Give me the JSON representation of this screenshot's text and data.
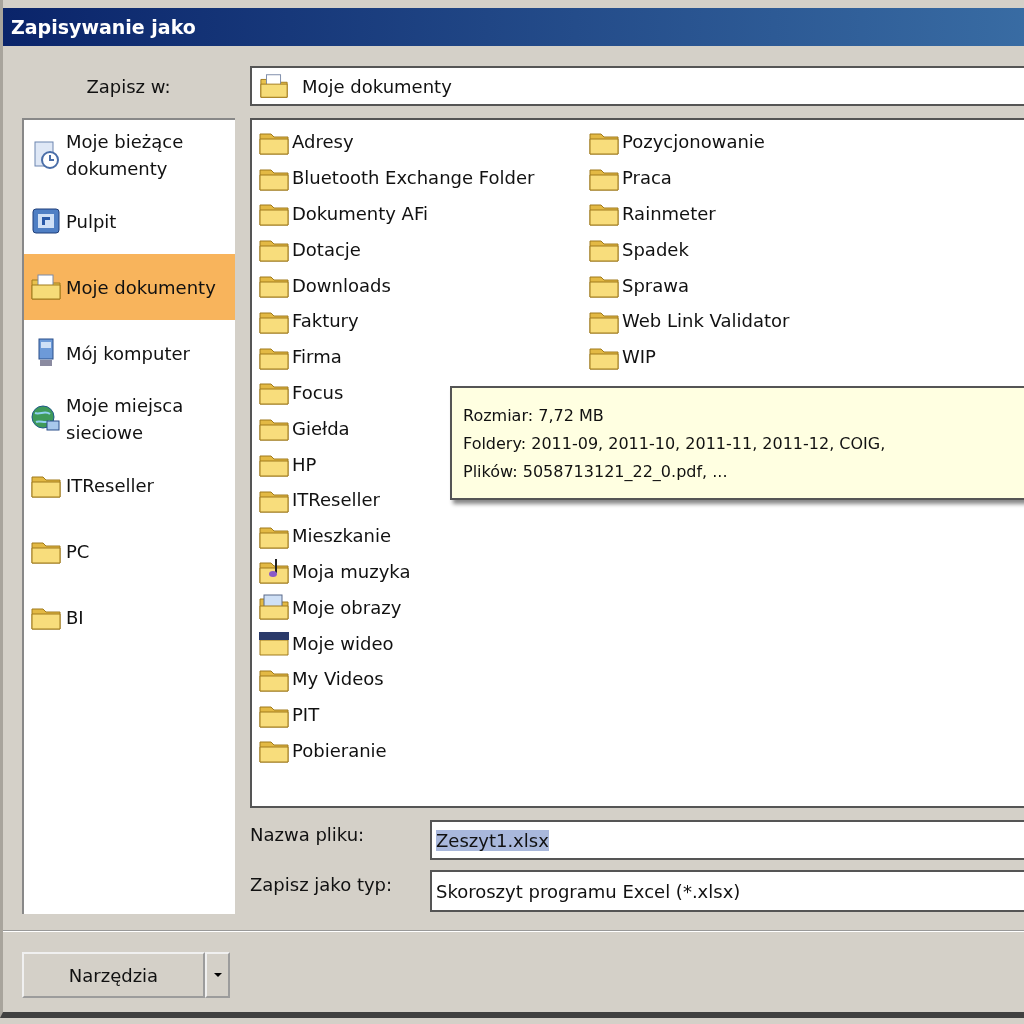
{
  "window": {
    "title": "Zapisywanie jako"
  },
  "location": {
    "label": "Zapisz w:",
    "value": "Moje dokumenty"
  },
  "places": [
    {
      "label": "Moje bieżące dokumenty",
      "kind": "recent",
      "selected": false
    },
    {
      "label": "Pulpit",
      "kind": "desktop",
      "selected": false
    },
    {
      "label": "Moje dokumenty",
      "kind": "documents",
      "selected": true
    },
    {
      "label": "Mój komputer",
      "kind": "computer",
      "selected": false
    },
    {
      "label": "Moje miejsca sieciowe",
      "kind": "network",
      "selected": false
    },
    {
      "label": "ITReseller",
      "kind": "folder",
      "selected": false
    },
    {
      "label": "PC",
      "kind": "folder",
      "selected": false
    },
    {
      "label": "BI",
      "kind": "folder",
      "selected": false
    }
  ],
  "files": [
    {
      "name": "Adresy",
      "kind": "folder"
    },
    {
      "name": "Bluetooth Exchange Folder",
      "kind": "folder"
    },
    {
      "name": "Dokumenty AFi",
      "kind": "folder"
    },
    {
      "name": "Dotacje",
      "kind": "folder"
    },
    {
      "name": "Downloads",
      "kind": "folder"
    },
    {
      "name": "Faktury",
      "kind": "folder"
    },
    {
      "name": "Firma",
      "kind": "folder"
    },
    {
      "name": "Focus",
      "kind": "folder"
    },
    {
      "name": "Giełda",
      "kind": "folder"
    },
    {
      "name": "HP",
      "kind": "folder"
    },
    {
      "name": "ITReseller",
      "kind": "folder"
    },
    {
      "name": "Mieszkanie",
      "kind": "folder"
    },
    {
      "name": "Moja muzyka",
      "kind": "music"
    },
    {
      "name": "Moje obrazy",
      "kind": "pictures"
    },
    {
      "name": "Moje wideo",
      "kind": "video"
    },
    {
      "name": "My Videos",
      "kind": "folder"
    },
    {
      "name": "PIT",
      "kind": "folder"
    },
    {
      "name": "Pobieranie",
      "kind": "folder"
    },
    {
      "name": "Pozycjonowanie",
      "kind": "folder"
    },
    {
      "name": "Praca",
      "kind": "folder"
    },
    {
      "name": "Rainmeter",
      "kind": "folder"
    },
    {
      "name": "Spadek",
      "kind": "folder"
    },
    {
      "name": "Sprawa",
      "kind": "folder"
    },
    {
      "name": "Web Link Validator",
      "kind": "folder"
    },
    {
      "name": "WIP",
      "kind": "folder"
    }
  ],
  "tooltip": {
    "lines": [
      "Rozmiar: 7,72 MB",
      "Foldery: 2011-09, 2011-10, 2011-11, 2011-12, COIG,",
      "Plików: 5058713121_22_0.pdf, ..."
    ]
  },
  "file_name": {
    "label": "Nazwa pliku:",
    "value": "Zeszyt1.xlsx",
    "selected": true
  },
  "file_type": {
    "label": "Zapisz jako typ:",
    "value": "Skoroszyt programu Excel (*.xlsx)"
  },
  "tools_button": {
    "label": "Narzędzia"
  }
}
